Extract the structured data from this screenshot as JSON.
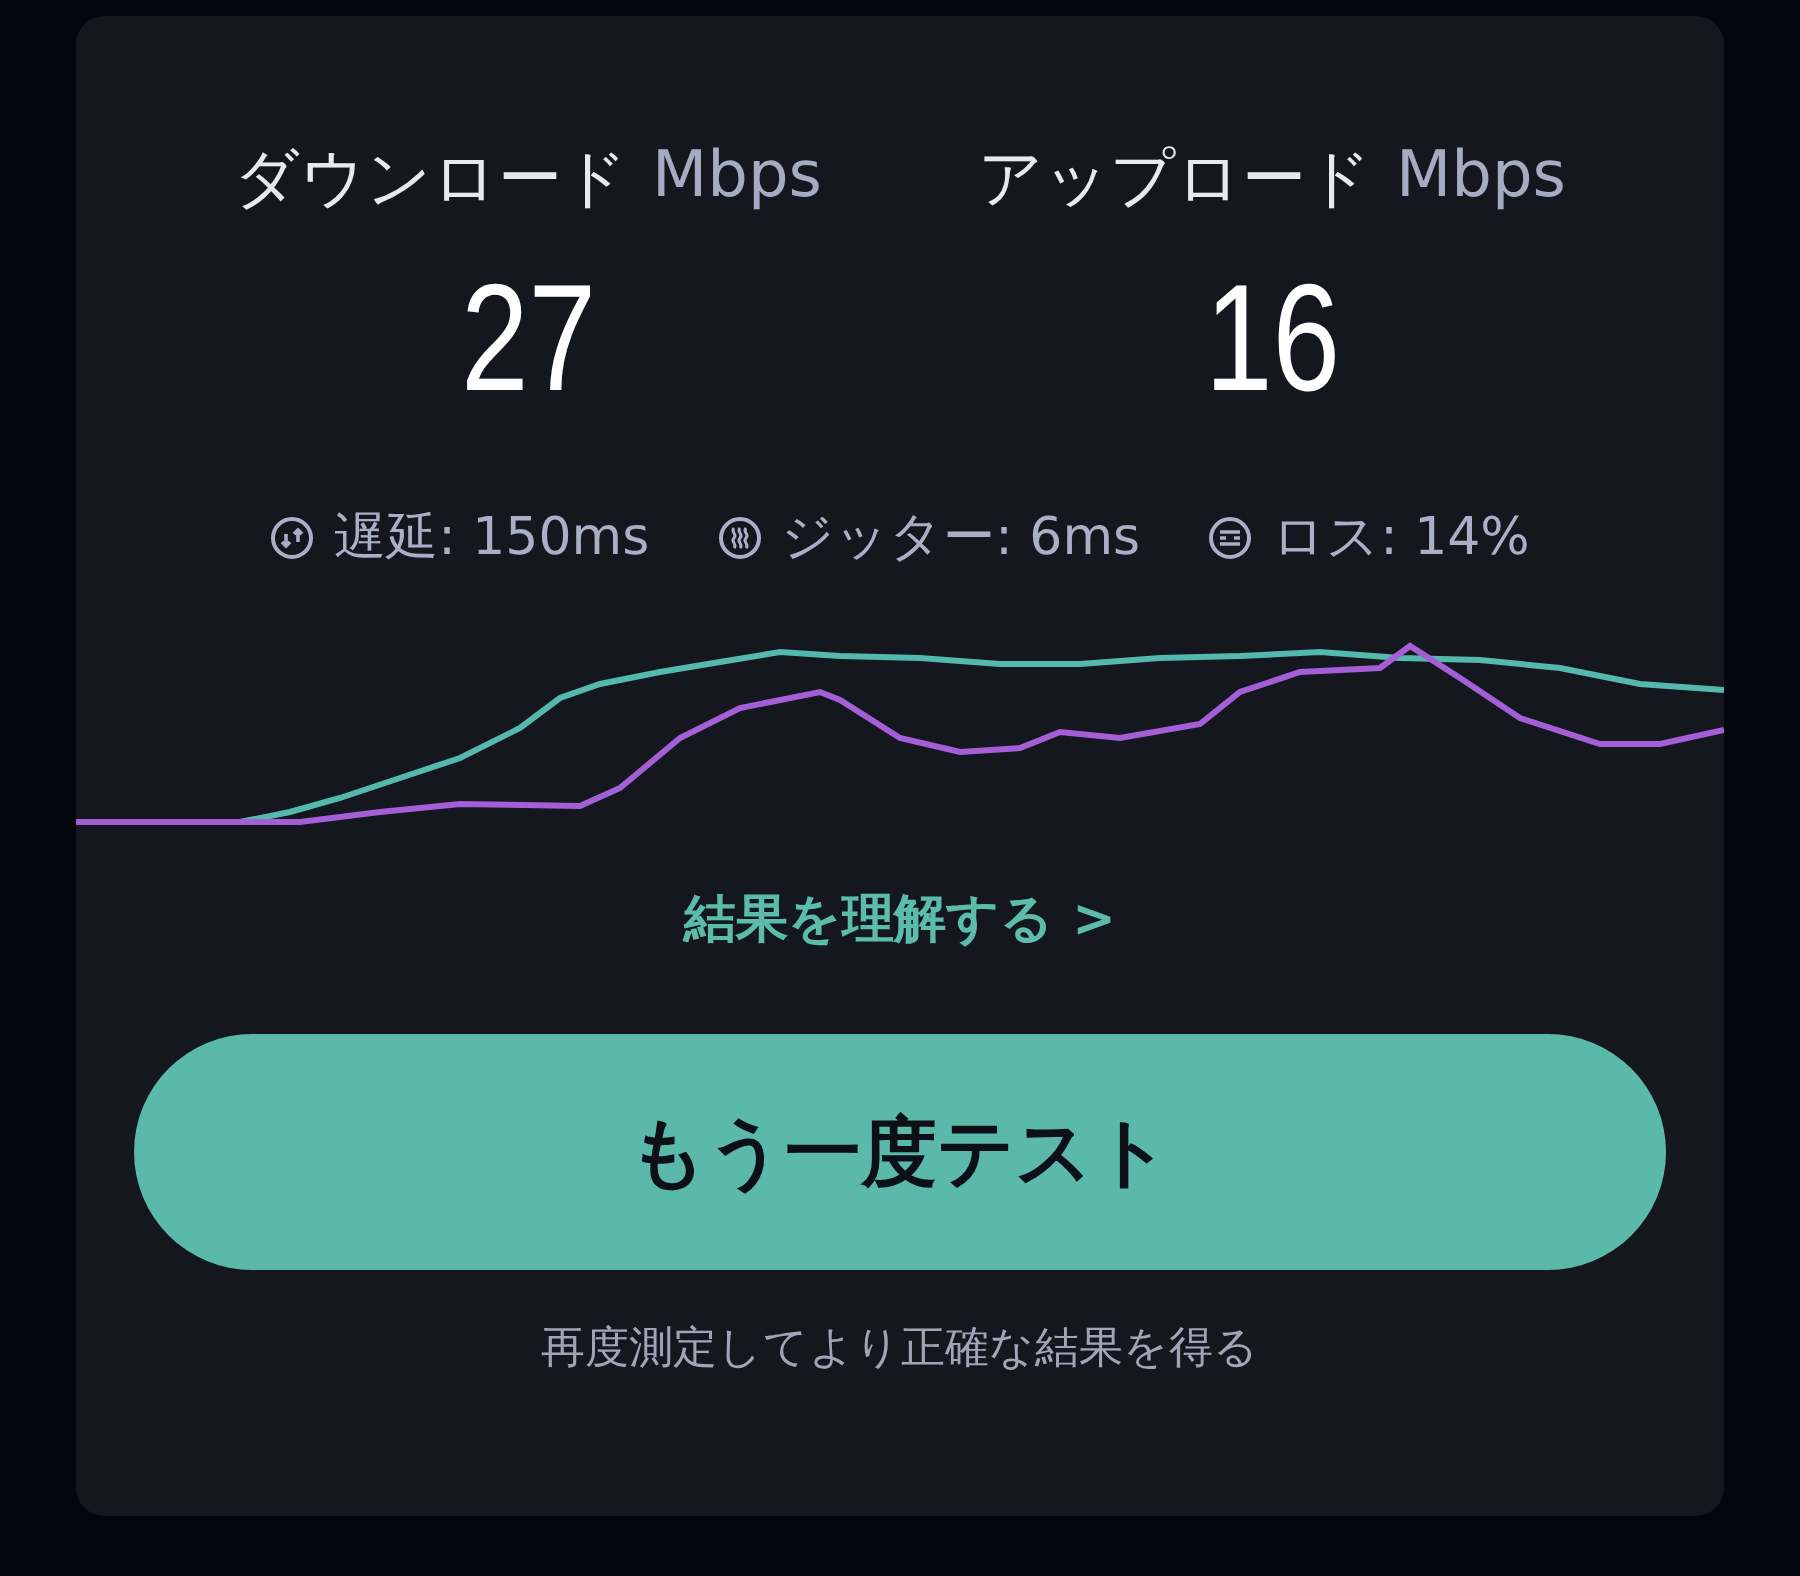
{
  "results": [
    {
      "label": "ダウンロード",
      "unit": "Mbps",
      "value": "27"
    },
    {
      "label": "アップロード",
      "unit": "Mbps",
      "value": "16"
    }
  ],
  "stats": [
    {
      "kind": "latency",
      "text": "遅延: 150ms"
    },
    {
      "kind": "jitter",
      "text": "ジッター: 6ms"
    },
    {
      "kind": "loss",
      "text": "ロス: 14%"
    }
  ],
  "link": "結果を理解する >",
  "button": "もう一度テスト",
  "footnote": "再度測定してより正確な結果を得る"
}
